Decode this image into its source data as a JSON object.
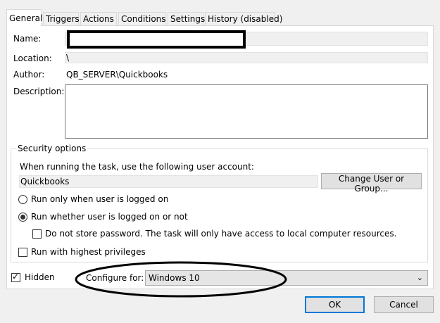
{
  "tabs": [
    "General",
    "Triggers",
    "Actions",
    "Conditions",
    "Settings",
    "History (disabled)"
  ],
  "general": {
    "name_label": "Name:",
    "name_value": "",
    "location_label": "Location:",
    "location_value": "\\",
    "author_label": "Author:",
    "author_value": "QB_SERVER\\Quickbooks",
    "description_label": "Description:",
    "description_value": ""
  },
  "security": {
    "legend": "Security options",
    "account_prompt": "When running the task, use the following user account:",
    "account_value": "Quickbooks",
    "change_button": "Change User or Group...",
    "opt_logged_on": "Run only when user is logged on",
    "opt_whether": "Run whether user is logged on or not",
    "opt_no_store": "Do not store password.  The task will only have access to local computer resources.",
    "opt_highest": "Run with highest privileges",
    "selected": "Run whether user is logged on or not"
  },
  "footer": {
    "hidden_label": "Hidden",
    "hidden_checked": true,
    "configure_label": "Configure for:",
    "configure_value": "Windows 10"
  },
  "buttons": {
    "ok": "OK",
    "cancel": "Cancel"
  }
}
